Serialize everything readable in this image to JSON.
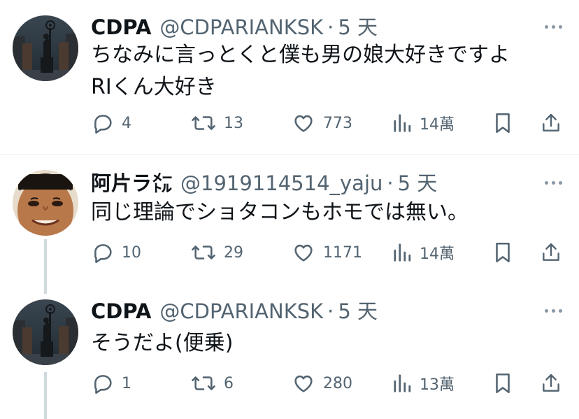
{
  "tweets": [
    {
      "display_name": "CDPA",
      "handle": "@CDPARIANKSK",
      "separator": "·",
      "time": "5 天",
      "text": "ちなみに言っとくと僕も男の娘大好きですよ\nRIくん大好き",
      "avatar_icon": "statue-avatar",
      "replies": "4",
      "retweets": "13",
      "likes": "773",
      "views": "14萬"
    },
    {
      "display_name": "阿片ラ㍍",
      "handle": "@1919114514_yaju",
      "separator": "·",
      "time": "5 天",
      "text": "同じ理論でショタコンもホモでは無い。",
      "avatar_icon": "face-avatar",
      "replies": "10",
      "retweets": "29",
      "likes": "1171",
      "views": "14萬"
    },
    {
      "display_name": "CDPA",
      "handle": "@CDPARIANKSK",
      "separator": "·",
      "time": "5 天",
      "text": "そうだよ(便乗)",
      "avatar_icon": "statue-avatar",
      "replies": "1",
      "retweets": "6",
      "likes": "280",
      "views": "13萬"
    }
  ],
  "colors": {
    "text": "#0f1419",
    "secondary": "#536471",
    "divider": "#eff3f4",
    "thread_line": "#cfd9de"
  }
}
